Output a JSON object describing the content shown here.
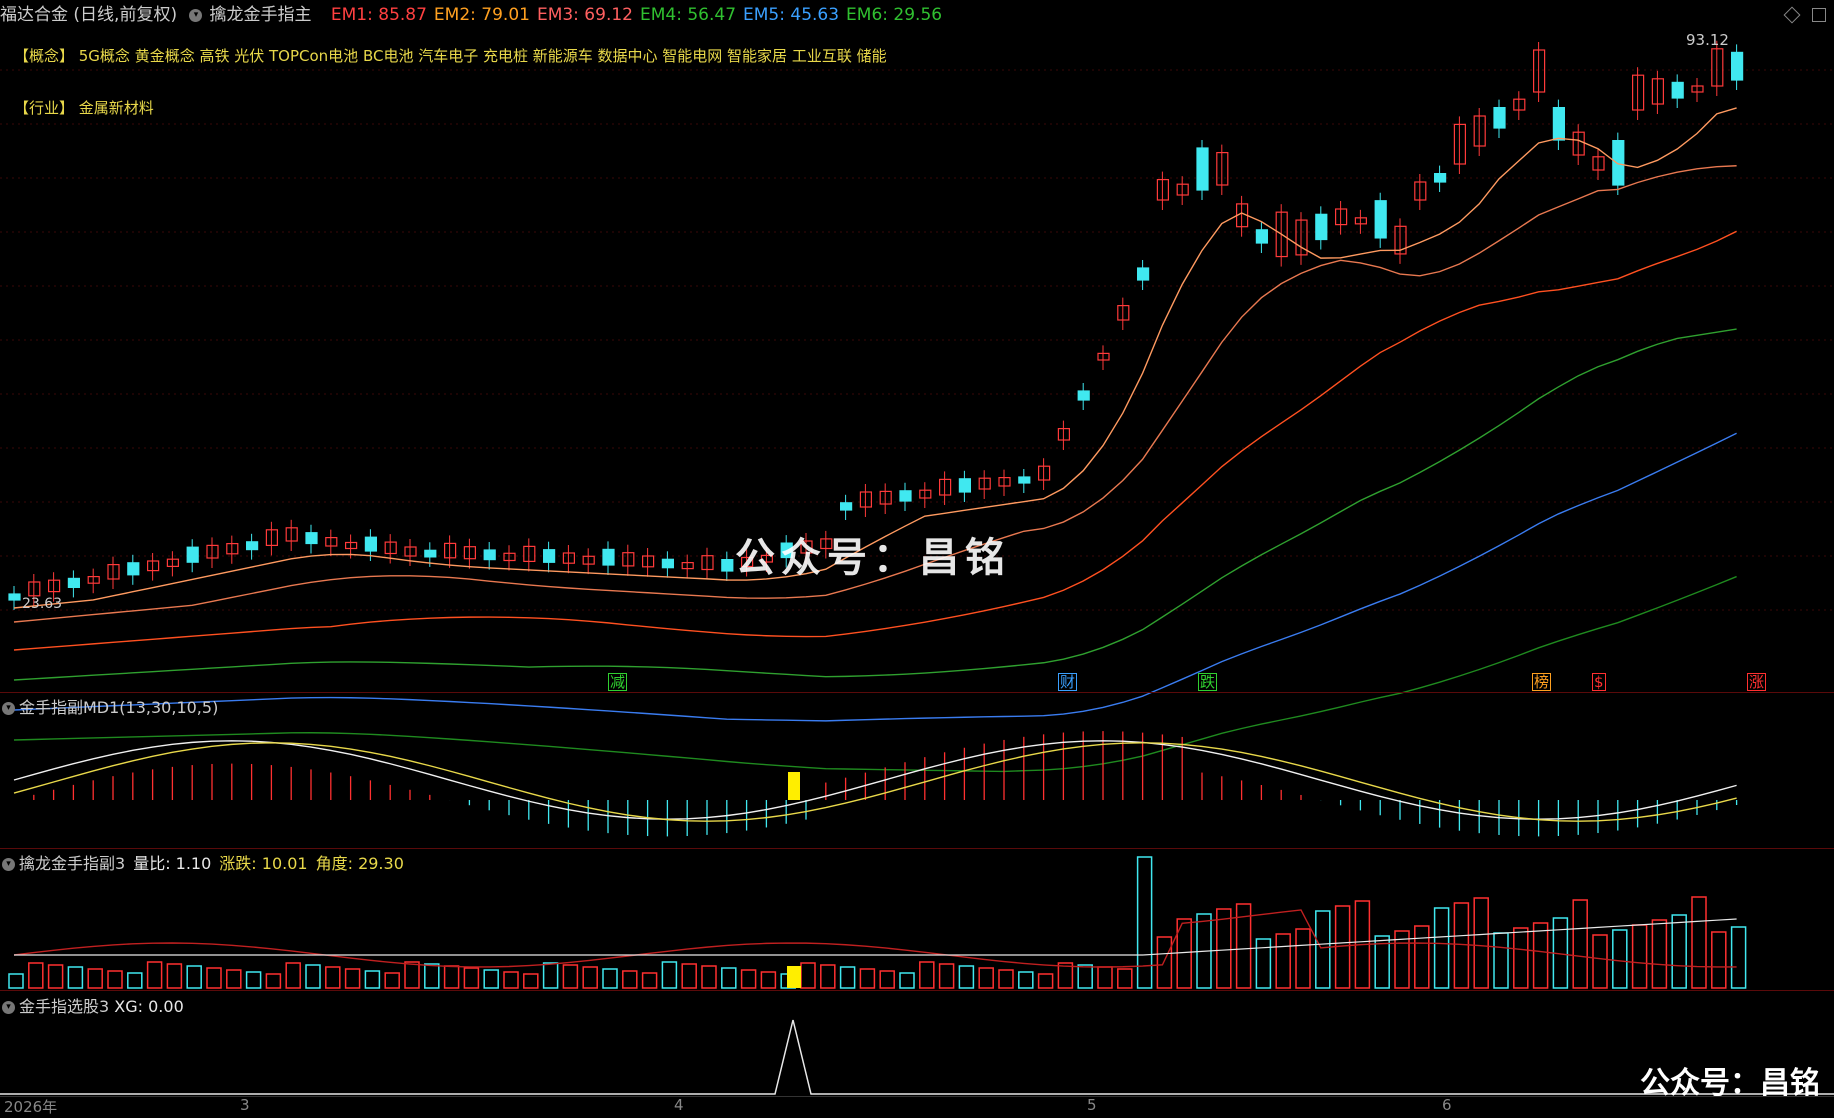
{
  "header": {
    "stock": "福达合金 (日线,前复权)",
    "indicator": "擒龙金手指主",
    "em": [
      {
        "label": "EM1: 85.87",
        "color": "#ff4040"
      },
      {
        "label": "EM2: 79.01",
        "color": "#ffa020"
      },
      {
        "label": "EM3: 69.12",
        "color": "#ff6060"
      },
      {
        "label": "EM4: 56.47",
        "color": "#30c030"
      },
      {
        "label": "EM5: 45.63",
        "color": "#3aa0ff"
      },
      {
        "label": "EM6: 29.56",
        "color": "#30c030"
      }
    ]
  },
  "info": {
    "concept": "【概念】 5G概念 黄金概念 高铁 光伏 TOPCon电池 BC电池 汽车电子 充电桩 新能源车 数据中心 智能电网 智能家居 工业互联 储能",
    "industry": "【行业】 金属新材料"
  },
  "main_chart": {
    "price_high_label": "93.12",
    "price_low_label": "23.63",
    "markers": [
      {
        "text": "减",
        "color": "#30d030"
      },
      {
        "text": "财",
        "color": "#3aa0ff"
      },
      {
        "text": "跌",
        "color": "#30d030"
      },
      {
        "text": "榜",
        "color": "#ffa020"
      },
      {
        "text": "$",
        "color": "#ff3030"
      },
      {
        "text": "涨",
        "color": "#ff3030"
      }
    ]
  },
  "panel2": {
    "title": "金手指副MD1(13,30,10,5)"
  },
  "panel3": {
    "title": "擒龙金手指副3",
    "values": [
      {
        "label": "量比: 1.10",
        "color": "#e8e8e8"
      },
      {
        "label": "涨跌: 10.01",
        "color": "#e8d84a"
      },
      {
        "label": "角度: 29.30",
        "color": "#e8d84a"
      }
    ]
  },
  "panel4": {
    "title": "金手指选股3",
    "xg": "XG: 0.00"
  },
  "xaxis": {
    "labels": [
      "2026年",
      "3",
      "4",
      "5",
      "6"
    ]
  },
  "watermark": {
    "center": "公众号：昌铭",
    "corner": "公众号：昌铭"
  }
}
